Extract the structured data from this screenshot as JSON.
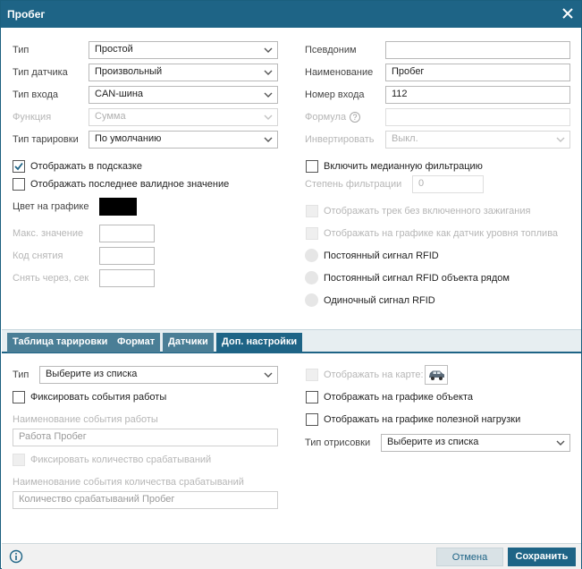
{
  "dialog": {
    "title": "Пробег",
    "close_icon": "close-icon"
  },
  "left": {
    "type": {
      "label": "Тип",
      "value": "Простой"
    },
    "sensor_type": {
      "label": "Тип датчика",
      "value": "Произвольный"
    },
    "input_type": {
      "label": "Тип входа",
      "value": "CAN-шина"
    },
    "function": {
      "label": "Функция",
      "value": "Сумма"
    },
    "calibration_type": {
      "label": "Тип тарировки",
      "value": "По умолчанию"
    },
    "show_in_tooltip": {
      "label": "Отображать в подсказке",
      "checked": true
    },
    "show_last_valid": {
      "label": "Отображать последнее валидное значение",
      "checked": false
    },
    "graph_color": {
      "label": "Цвет на графике",
      "color": "#000000"
    },
    "max_value": {
      "label": "Макс. значение",
      "value": ""
    },
    "read_code": {
      "label": "Код снятия",
      "value": ""
    },
    "read_after": {
      "label": "Снять через, сек",
      "value": ""
    }
  },
  "right": {
    "alias": {
      "label": "Псевдоним",
      "value": ""
    },
    "name": {
      "label": "Наименование",
      "value": "Пробег"
    },
    "input_number": {
      "label": "Номер входа",
      "value": "112"
    },
    "formula": {
      "label": "Формула",
      "help_icon": "?",
      "value": ""
    },
    "invert": {
      "label": "Инвертировать",
      "value": "Выкл."
    },
    "median_filter": {
      "label": "Включить медианную фильтрацию",
      "checked": false
    },
    "filter_degree": {
      "label": "Степень фильтрации",
      "value": "0"
    },
    "track_no_ignition": {
      "label": "Отображать трек без включенного зажигания"
    },
    "fuel_level_graph": {
      "label": "Отображать на графике как датчик уровня топлива"
    },
    "rfid_constant": {
      "label": "Постоянный сигнал RFID"
    },
    "rfid_constant_near": {
      "label": "Постоянный сигнал RFID объекта рядом"
    },
    "rfid_single": {
      "label": "Одиночный сигнал RFID"
    }
  },
  "tabs": [
    {
      "label": "Таблица тарировки",
      "active": false
    },
    {
      "label": "Формат",
      "active": false
    },
    {
      "label": "Датчики",
      "active": false
    },
    {
      "label": "Доп. настройки",
      "active": true
    }
  ],
  "extra": {
    "type": {
      "label": "Тип",
      "value": "Выберите из списка"
    },
    "fix_events": {
      "label": "Фиксировать события работы",
      "checked": false
    },
    "event_name_label": "Наименование события работы",
    "event_name_value": "Работа Пробег",
    "fix_count": {
      "label": "Фиксировать количество срабатываний"
    },
    "count_name_label": "Наименование события количества срабатываний",
    "count_name_value": "Количество срабатываний Пробег",
    "show_on_map": {
      "label": "Отображать на карте:",
      "icon": "car-icon"
    },
    "show_object_graph": {
      "label": "Отображать на графике объекта",
      "checked": false
    },
    "show_payload_graph": {
      "label": "Отображать на графике полезной нагрузки",
      "checked": false
    },
    "draw_type": {
      "label": "Тип отрисовки",
      "value": "Выберите из списка"
    }
  },
  "footer": {
    "info_icon": "info-icon",
    "cancel": "Отмена",
    "save": "Сохранить"
  },
  "colors": {
    "accent": "#1e6486",
    "tab_inactive": "#4a7e96",
    "disabled_text": "#b6b6b6"
  }
}
